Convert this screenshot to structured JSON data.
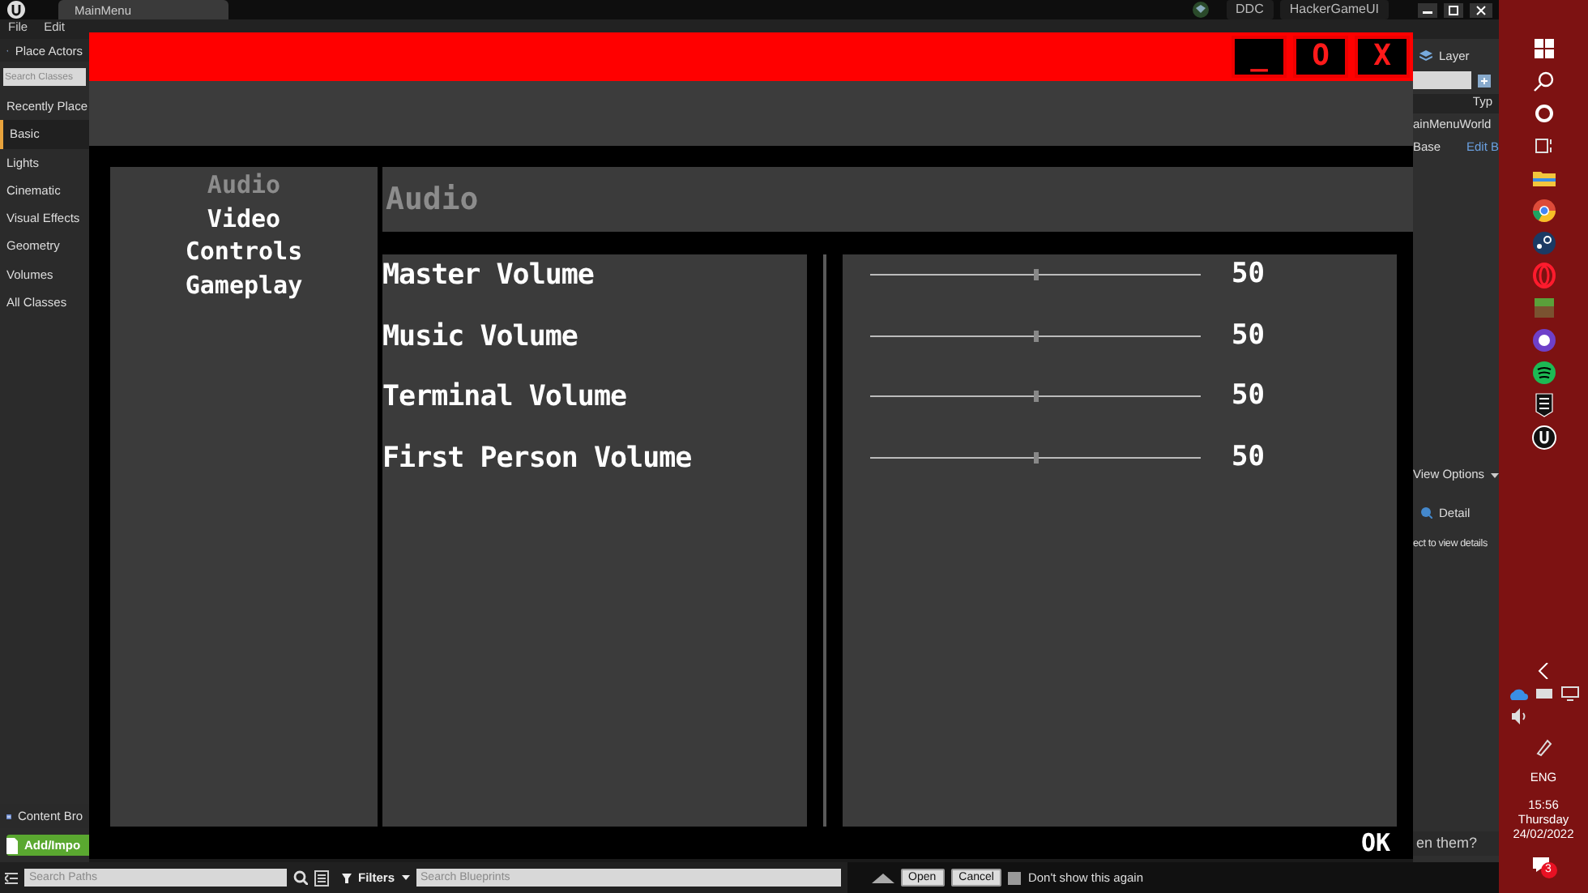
{
  "editor": {
    "tab": "MainMenu",
    "badges": [
      "DDC",
      "HackerGameUI"
    ],
    "menu": [
      "File",
      "Edit"
    ],
    "place_actors": {
      "title": "Place Actors",
      "search": {
        "placeholder": "Search Classes"
      },
      "categories": [
        {
          "label": "Recently Place",
          "selected": false
        },
        {
          "label": "Basic",
          "selected": true
        },
        {
          "label": "Lights",
          "selected": false
        },
        {
          "label": "Cinematic",
          "selected": false
        },
        {
          "label": "Visual Effects",
          "selected": false
        },
        {
          "label": "Geometry",
          "selected": false
        },
        {
          "label": "Volumes",
          "selected": false
        },
        {
          "label": "All Classes",
          "selected": false
        }
      ]
    },
    "content_browser": {
      "tab": "Content Bro",
      "add_button": "Add/Impo",
      "search_paths": {
        "placeholder": "Search Paths"
      },
      "filters": "Filters",
      "search_blueprints": {
        "placeholder": "Search Blueprints"
      }
    },
    "outliner": {
      "tab": "Layer",
      "column": "Typ",
      "rows": [
        {
          "name": "ainMenuWorld"
        },
        {
          "name": "Base",
          "link": "Edit B"
        }
      ],
      "view_options": "View Options"
    },
    "details": {
      "tab": "Detail",
      "hint": "ect to view details"
    },
    "dialog": {
      "question": "en them?",
      "buttons": [
        "Open",
        "Cancel"
      ],
      "checkbox": {
        "label": "Don't show this again",
        "checked": false
      }
    }
  },
  "game_window": {
    "controls": [
      "_",
      "O",
      "X"
    ],
    "nav": [
      {
        "label": "Audio",
        "selected": true
      },
      {
        "label": "Video",
        "selected": false
      },
      {
        "label": "Controls",
        "selected": false
      },
      {
        "label": "Gameplay",
        "selected": false
      }
    ],
    "section_title": "Audio",
    "settings": [
      {
        "label": "Master Volume",
        "level": 0.5,
        "value": "50"
      },
      {
        "label": "Music Volume",
        "level": 0.5,
        "value": "50"
      },
      {
        "label": "Terminal Volume",
        "level": 0.5,
        "value": "50"
      },
      {
        "label": "First Person Volume",
        "level": 0.5,
        "value": "50"
      }
    ],
    "ok_button": "OK"
  },
  "taskbar": {
    "language": "ENG",
    "time": "15:56",
    "day": "Thursday",
    "date": "24/02/2022",
    "notifications": "3"
  }
}
